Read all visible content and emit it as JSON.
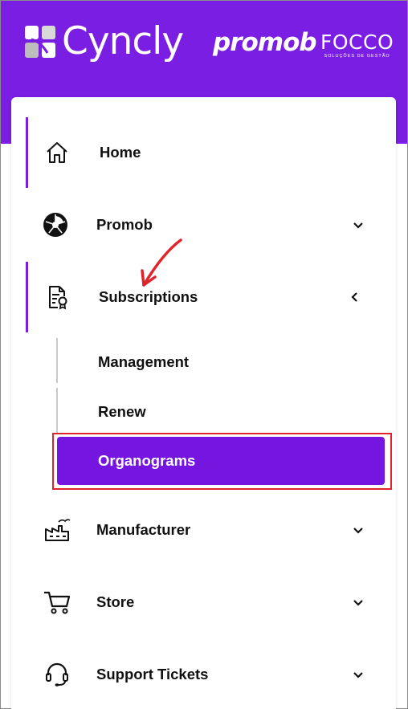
{
  "header": {
    "brand_cyncly": "Cyncly",
    "brand_promob": "promob",
    "brand_focco": "FOCCO",
    "brand_focco_tagline": "SOLUÇÕES DE GESTÃO"
  },
  "nav": {
    "items": [
      {
        "label": "Home",
        "icon": "home-icon",
        "active": true
      },
      {
        "label": "Promob",
        "icon": "promob-icon",
        "chevron": "down"
      },
      {
        "label": "Subscriptions",
        "icon": "subscription-certificate-icon",
        "chevron": "left",
        "active": true,
        "children": [
          {
            "label": "Management"
          },
          {
            "label": "Renew"
          },
          {
            "label": "Organograms",
            "selected": true
          }
        ]
      },
      {
        "label": "Manufacturer",
        "icon": "factory-icon",
        "chevron": "down"
      },
      {
        "label": "Store",
        "icon": "cart-icon",
        "chevron": "down"
      },
      {
        "label": "Support Tickets",
        "icon": "headset-icon",
        "chevron": "down"
      }
    ]
  },
  "colors": {
    "brand_purple": "#7a1ee4",
    "selected_bg": "#7515e0",
    "annotation_red": "#e0242c"
  }
}
